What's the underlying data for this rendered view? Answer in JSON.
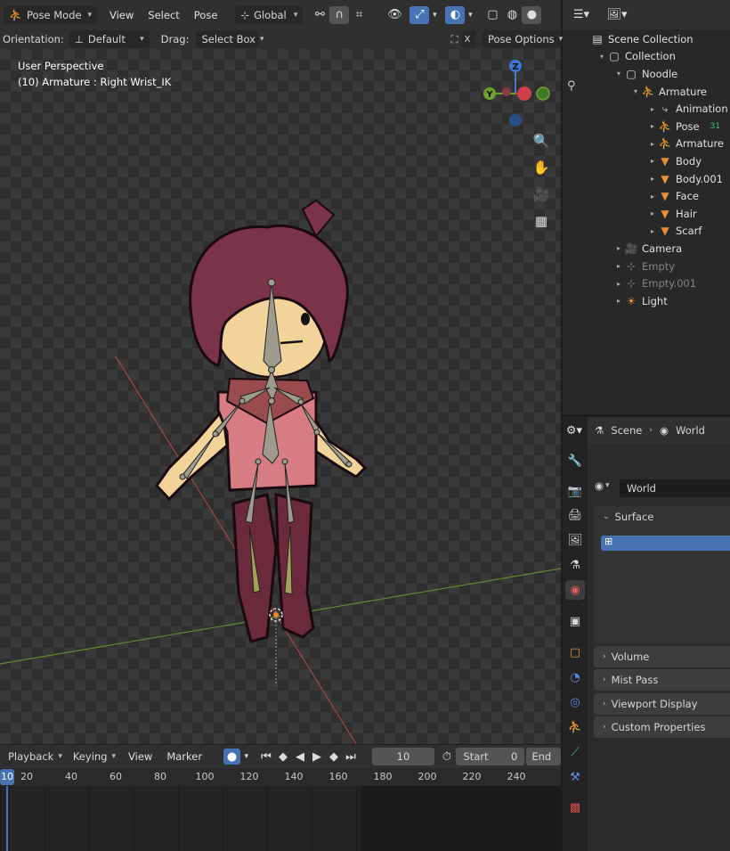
{
  "header": {
    "mode_label": "Pose Mode",
    "menus": [
      "View",
      "Select",
      "Pose"
    ],
    "transform_orientation": "Global",
    "orientation_label": "Orientation:",
    "orientation_value": "Default",
    "drag_label": "Drag:",
    "drag_value": "Select Box",
    "x_mirror": "X",
    "pose_options": "Pose Options"
  },
  "viewport": {
    "perspective": "User Perspective",
    "object_info": "(10) Armature : Right Wrist_IK",
    "gizmo": {
      "z": "Z",
      "y": "Y"
    }
  },
  "outliner": {
    "items": [
      {
        "label": "Scene Collection",
        "icon": "scene-collection-icon",
        "depth": 0,
        "dim": false
      },
      {
        "label": "Collection",
        "icon": "collection-icon",
        "depth": 1,
        "dim": false
      },
      {
        "label": "Noodle",
        "icon": "collection-icon",
        "depth": 2,
        "dim": false
      },
      {
        "label": "Armature",
        "icon": "armature-icon",
        "depth": 3,
        "dim": false
      },
      {
        "label": "Animation",
        "icon": "animation-icon",
        "depth": 4,
        "dim": false
      },
      {
        "label": "Pose",
        "icon": "pose-icon",
        "depth": 4,
        "dim": false,
        "extra": "31"
      },
      {
        "label": "Armature",
        "icon": "armature-data-icon",
        "depth": 4,
        "dim": false
      },
      {
        "label": "Body",
        "icon": "mesh-icon",
        "depth": 4,
        "dim": false
      },
      {
        "label": "Body.001",
        "icon": "mesh-icon",
        "depth": 4,
        "dim": false
      },
      {
        "label": "Face",
        "icon": "mesh-icon",
        "depth": 4,
        "dim": false
      },
      {
        "label": "Hair",
        "icon": "mesh-icon",
        "depth": 4,
        "dim": false
      },
      {
        "label": "Scarf",
        "icon": "mesh-icon",
        "depth": 4,
        "dim": false
      },
      {
        "label": "Camera",
        "icon": "camera-icon",
        "depth": 2,
        "dim": false
      },
      {
        "label": "Empty",
        "icon": "empty-icon",
        "depth": 2,
        "dim": true
      },
      {
        "label": "Empty.001",
        "icon": "empty-icon",
        "depth": 2,
        "dim": true
      },
      {
        "label": "Light",
        "icon": "light-icon",
        "depth": 2,
        "dim": false
      }
    ]
  },
  "properties": {
    "breadcrumb_scene": "Scene",
    "breadcrumb_world": "World",
    "world_name": "World",
    "panels": {
      "surface": "Surface",
      "volume": "Volume",
      "mist": "Mist Pass",
      "viewport_display": "Viewport Display",
      "custom_properties": "Custom Properties"
    }
  },
  "timeline": {
    "menus": {
      "playback": "Playback",
      "keying": "Keying",
      "view": "View",
      "marker": "Marker"
    },
    "current_frame": "10",
    "start_label": "Start",
    "start_value": "0",
    "end_label": "End",
    "ruler": [
      "10",
      "20",
      "40",
      "60",
      "80",
      "100",
      "120",
      "140",
      "160",
      "180",
      "200",
      "220",
      "240"
    ]
  },
  "colors": {
    "accent": "#4772b3",
    "hair": "#7a3348",
    "skin": "#f2d49a",
    "shirt": "#d67d84",
    "pants": "#6a2a3c",
    "bone": "#9e9a8e",
    "mesh_icon": "#e8913a",
    "armature_icon": "#d9a772"
  }
}
